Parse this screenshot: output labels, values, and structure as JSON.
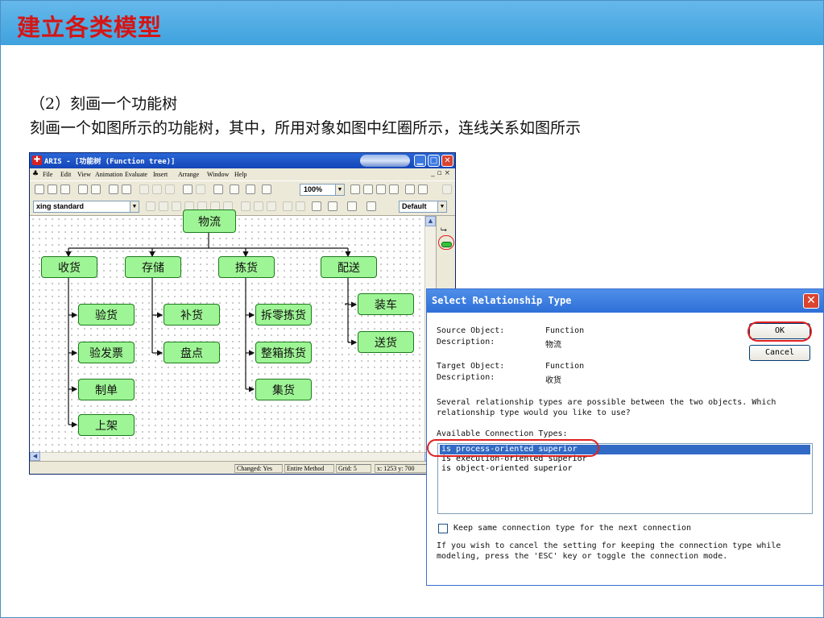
{
  "slide": {
    "title": "建立各类模型",
    "heading": "（2）刻画一个功能树",
    "description": "刻画一个如图所示的功能树，其中，所用对象如图中红圈所示，连线关系如图所示"
  },
  "aris_window": {
    "title": "ARIS - [功能树 (Function tree)]",
    "menu": [
      "File",
      "Edit",
      "View",
      "Animation",
      "Evaluate",
      "Insert",
      "Arrange",
      "Window",
      "Help"
    ],
    "zoom": "100%",
    "font": "xing standard",
    "style": "Default",
    "status": {
      "changed": "Changed: Yes",
      "scope": "Entire Method",
      "grid": "Grid: 5",
      "coords": "x: 1253 y: 700"
    }
  },
  "function_tree": {
    "root": "物流",
    "branches": [
      {
        "label": "收货",
        "children": [
          "验货",
          "验发票",
          "制单",
          "上架"
        ]
      },
      {
        "label": "存储",
        "children": [
          "补货",
          "盘点"
        ]
      },
      {
        "label": "拣货",
        "children": [
          "拆零拣货",
          "整箱拣货",
          "集货"
        ]
      },
      {
        "label": "配送",
        "children": [
          "装车",
          "送货"
        ]
      }
    ]
  },
  "dialog": {
    "title": "Select Relationship Type",
    "source_object_label": "Source Object:",
    "source_object_value": "Function",
    "source_desc_label": "Description:",
    "source_desc_value": "物流",
    "target_object_label": "Target Object:",
    "target_object_value": "Function",
    "target_desc_label": "Description:",
    "target_desc_value": "收货",
    "ok": "OK",
    "cancel": "Cancel",
    "question_line1": "Several relationship types are possible between the two objects. Which",
    "question_line2": "relationship type would you like to use?",
    "list_label": "Available Connection Types:",
    "connection_types": [
      "is process-oriented superior",
      "is execution-oriented superior",
      "is object-oriented superior"
    ],
    "selected_index": 0,
    "keep_label": "Keep same connection type for the next connection",
    "keep_checked": false,
    "hint_line1": "If you wish to cancel the setting for keeping the connection type while",
    "hint_line2": "modeling, press the 'ESC' key or toggle the connection mode."
  },
  "colors": {
    "title_bar": "#45a6e0",
    "title_text": "#d41616",
    "node_fill": "#9ef595",
    "highlight": "#e02020",
    "selection": "#316ac5"
  }
}
